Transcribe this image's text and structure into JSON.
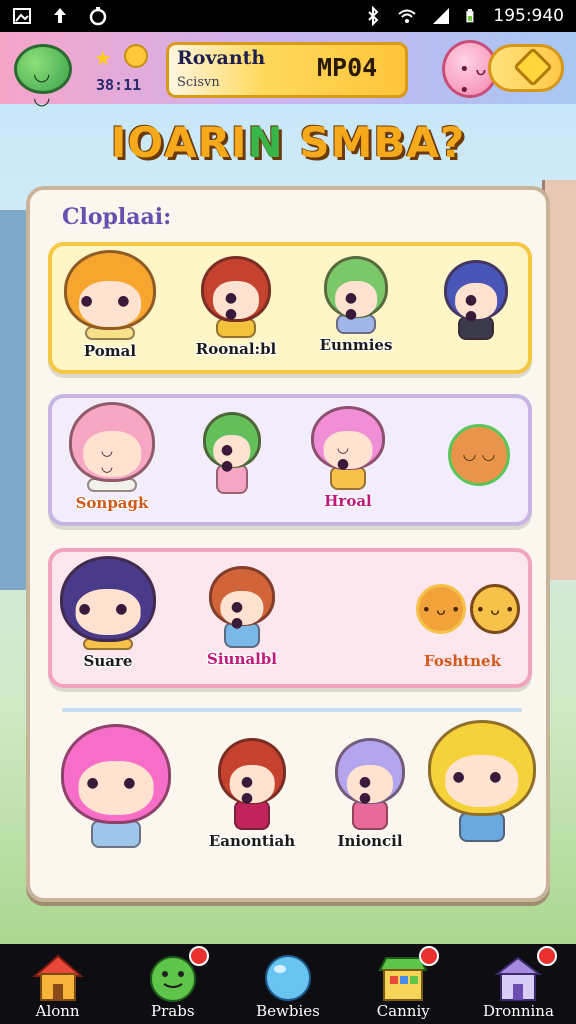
{
  "status_bar": {
    "time": "195:940",
    "icons": [
      "image-icon",
      "upload-icon",
      "sync-icon",
      "bluetooth-icon",
      "wifi-icon",
      "signal-icon",
      "battery-icon"
    ]
  },
  "header": {
    "stat_value": "38:11",
    "profile_name": "Rovanth",
    "profile_subtitle": "Scisvn",
    "currency_value": "MP04"
  },
  "title": {
    "part1": "ΙΟΑRΙ",
    "part2": "N",
    "part3": " SMBA?"
  },
  "panel": {
    "label": "Cloplaai:"
  },
  "rows": [
    {
      "characters": [
        {
          "name": "Pomal",
          "hair": "#f6a52e",
          "outfit": "#f7e28a"
        },
        {
          "name": "Roonal:bl",
          "hair": "#c4422e",
          "outfit": "#f2c33a"
        },
        {
          "name": "Eunmies",
          "hair": "#7bc86a",
          "outfit": "#9fb6e8"
        },
        {
          "name": "",
          "hair": "#4a55b8",
          "outfit": "#3a3a4a"
        }
      ]
    },
    {
      "characters": [
        {
          "name": "Sonpagk",
          "hair": "#f7a6c4",
          "outfit": "#f2f2e8"
        },
        {
          "name": "",
          "hair": "#64c05a",
          "outfit": "#f4a6c4"
        },
        {
          "name": "Hroal",
          "hair": "#f08ed6",
          "outfit": "#f6c24a"
        }
      ],
      "sticker": {
        "name": "",
        "color": "#e8944a",
        "ring": "#5ac65a"
      }
    },
    {
      "characters": [
        {
          "name": "Suare",
          "hair": "#4a3a8a",
          "outfit": "#f6c24a"
        },
        {
          "name": "Siunalbl",
          "hair": "#d2643a",
          "outfit": "#7ab8e8"
        }
      ],
      "sticker": {
        "name": "Foshtnek",
        "color": "#f2a23a",
        "ring": "#f6c24a"
      }
    },
    {
      "characters": [
        {
          "name": "",
          "hair": "#f76ec8",
          "outfit": "#9fc6ea"
        },
        {
          "name": "Eanontiah",
          "hair": "#c4422e",
          "outfit": "#c0245a"
        },
        {
          "name": "Inioncil",
          "hair": "#b4a6ee",
          "outfit": "#e86a9a"
        },
        {
          "name": "",
          "hair": "#f6d23a",
          "outfit": "#6aa8e0"
        }
      ]
    }
  ],
  "bottom_nav": [
    {
      "label": "Alonn",
      "icon": "house-icon"
    },
    {
      "label": "Prabs",
      "icon": "frog-icon"
    },
    {
      "label": "Bewbies",
      "icon": "bubble-icon"
    },
    {
      "label": "Canniy",
      "icon": "shop-icon"
    },
    {
      "label": "Dronnina",
      "icon": "castle-icon"
    }
  ]
}
